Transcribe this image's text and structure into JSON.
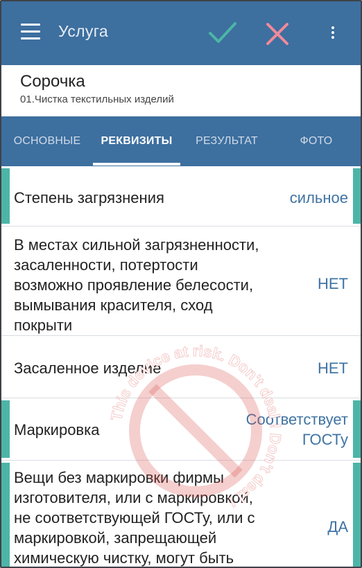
{
  "app_bar": {
    "title": "Услуга",
    "menu_icon": "hamburger-menu-icon",
    "confirm_icon": "checkmark-icon",
    "cancel_icon": "close-icon",
    "more_icon": "vertical-dots-icon",
    "colors": {
      "background": "#3d6f9f",
      "confirm": "#4cb5a7",
      "cancel": "#f08a9a"
    }
  },
  "item": {
    "title": "Сорочка",
    "subtitle": "01.Чистка текстильных изделий"
  },
  "tabs": [
    {
      "label": "ОСНОВНЫЕ",
      "active": false
    },
    {
      "label": "РЕКВИЗИТЫ",
      "active": true
    },
    {
      "label": "РЕЗУЛЬТАТ",
      "active": false
    },
    {
      "label": "ФОТО",
      "active": false
    }
  ],
  "requisites": [
    {
      "label_lines": [
        "Степень загрязнения"
      ],
      "value_lines": [
        "сильное"
      ],
      "highlighted": true
    },
    {
      "label_lines": [
        "В местах сильной загрязненности,",
        "засаленности, потертости",
        "возможно проявление белесости,",
        "вымывания красителя, сход",
        "покрыти"
      ],
      "value_lines": [
        "НЕТ"
      ],
      "highlighted": false
    },
    {
      "label_lines": [
        "Засаленное изделие"
      ],
      "value_lines": [
        "НЕТ"
      ],
      "highlighted": false
    },
    {
      "label_lines": [
        "Маркировка"
      ],
      "value_lines": [
        "Соответствует",
        "ГОСТу"
      ],
      "highlighted": true
    },
    {
      "label_lines": [
        "Вещи без маркировки фирмы",
        "изготовителя, или с маркировкой,",
        "не соответствующей ГОСТу, или с",
        "маркировкой, запрещающей",
        "химическую чистку, могут быть"
      ],
      "value_lines": [
        "ДА"
      ],
      "highlighted": true
    }
  ],
  "watermark": {
    "text": "This device at risk. Don't deal ! Don't deal !",
    "color": "#d9534f"
  },
  "colors": {
    "accent": "#4cb5a7",
    "value_text": "#3f73a3"
  }
}
